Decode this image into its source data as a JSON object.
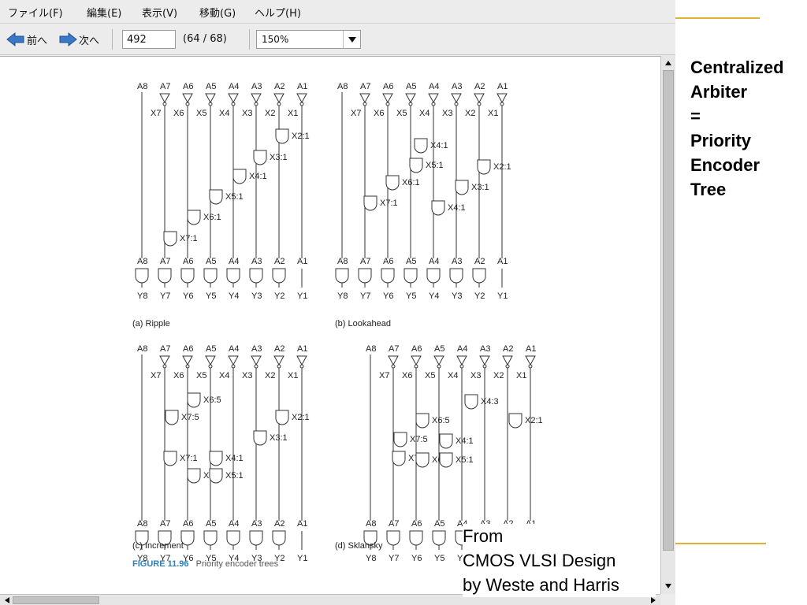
{
  "menu": [
    {
      "label": "ファイル(F)"
    },
    {
      "label": "編集(E)"
    },
    {
      "label": "表示(V)"
    },
    {
      "label": "移動(G)"
    },
    {
      "label": "ヘルプ(H)"
    }
  ],
  "toolbar": {
    "prev_label": "前へ",
    "next_label": "次へ",
    "page_value": "492",
    "page_count": "(64 / 68)",
    "zoom_value": "150%"
  },
  "figure": {
    "panels": {
      "ripple": "(a) Ripple",
      "lookahead": "(b) Lookahead",
      "increment": "(c) Increment",
      "sklansky": "(d) Sklansky"
    },
    "caption_number": "FIGURE 11.96",
    "caption_text": "Priority encoder trees",
    "input_labels": [
      "A8",
      "A7",
      "A6",
      "A5",
      "A4",
      "A3",
      "A2",
      "A1"
    ],
    "output_labels": [
      "Y8",
      "Y7",
      "Y6",
      "Y5",
      "Y4",
      "Y3",
      "Y2",
      "Y1"
    ],
    "inverted_labels": [
      "X7",
      "X6",
      "X5",
      "X4",
      "X3",
      "X2",
      "X1"
    ],
    "ripple_nodes": [
      "X2:1",
      "X3:1",
      "X4:1",
      "X5:1",
      "X6:1",
      "X7:1"
    ],
    "lookahead_nodes": [
      "X4:1",
      "X5:1",
      "X6:1",
      "X7:1",
      "X2:1",
      "X3:1",
      "X4:1"
    ],
    "increment_nodes": [
      "X6:5",
      "X7:5",
      "X2:1",
      "X3:1",
      "X4:1",
      "X7:1",
      "X6:1",
      "X5:1"
    ],
    "sklansky_nodes": [
      "X4:3",
      "X6:5",
      "X2:1",
      "X7:5",
      "X4:1",
      "X7:1",
      "X6:1",
      "X5:1"
    ]
  },
  "slide": {
    "title_lines": [
      "Centralized",
      "Arbiter",
      "=",
      "Priority",
      "Encoder",
      "Tree"
    ],
    "credit_lines": [
      "From",
      "CMOS VLSI Design",
      "by Weste and Harris"
    ]
  },
  "colors": {
    "gold": "#e0b030",
    "caption_blue": "#2a80c0",
    "prev_next_icon": "#3a78c8"
  }
}
